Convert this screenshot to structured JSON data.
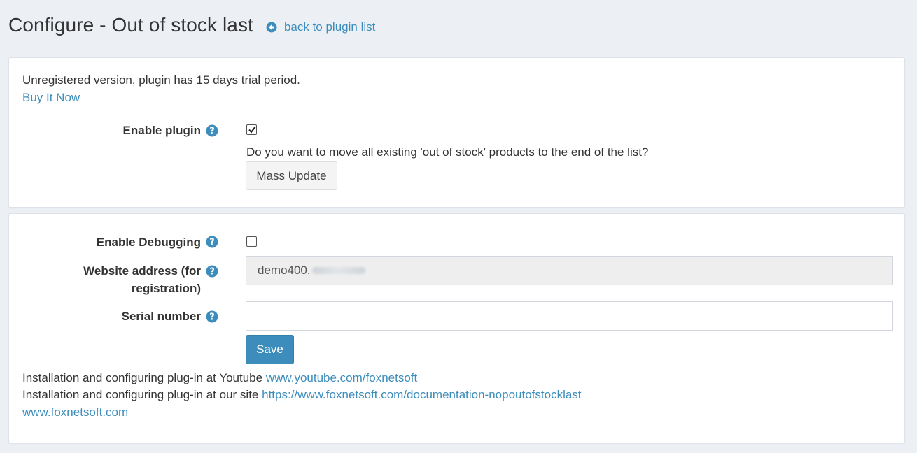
{
  "header": {
    "title": "Configure - Out of stock last",
    "back_link": "back to plugin list",
    "back_icon": "arrow-circle-left-icon"
  },
  "license": {
    "message": "Unregistered version, plugin has 15 days trial period.",
    "buy_link": "Buy It Now"
  },
  "settings": {
    "enable_plugin": {
      "label": "Enable plugin",
      "checked": true
    },
    "mass_update": {
      "question": "Do you want to move all existing 'out of stock' products to the end of the list?",
      "button": "Mass Update"
    },
    "enable_debugging": {
      "label": "Enable Debugging",
      "checked": false
    },
    "website_address": {
      "label_line1": "Website address (for",
      "label_line2": "registration)",
      "value": "demo400."
    },
    "serial_number": {
      "label": "Serial number",
      "value": ""
    },
    "save_button": "Save"
  },
  "footer": {
    "youtube_text": "Installation and configuring plug-in at Youtube",
    "youtube_link": "www.youtube.com/foxnetsoft",
    "site_text": "Installation and configuring plug-in at our site",
    "site_link": "https://www.foxnetsoft.com/documentation-nopoutofstocklast",
    "home_link": "www.foxnetsoft.com"
  },
  "colors": {
    "accent": "#3c8dbc",
    "background": "#ecf0f5",
    "panel": "#ffffff"
  }
}
